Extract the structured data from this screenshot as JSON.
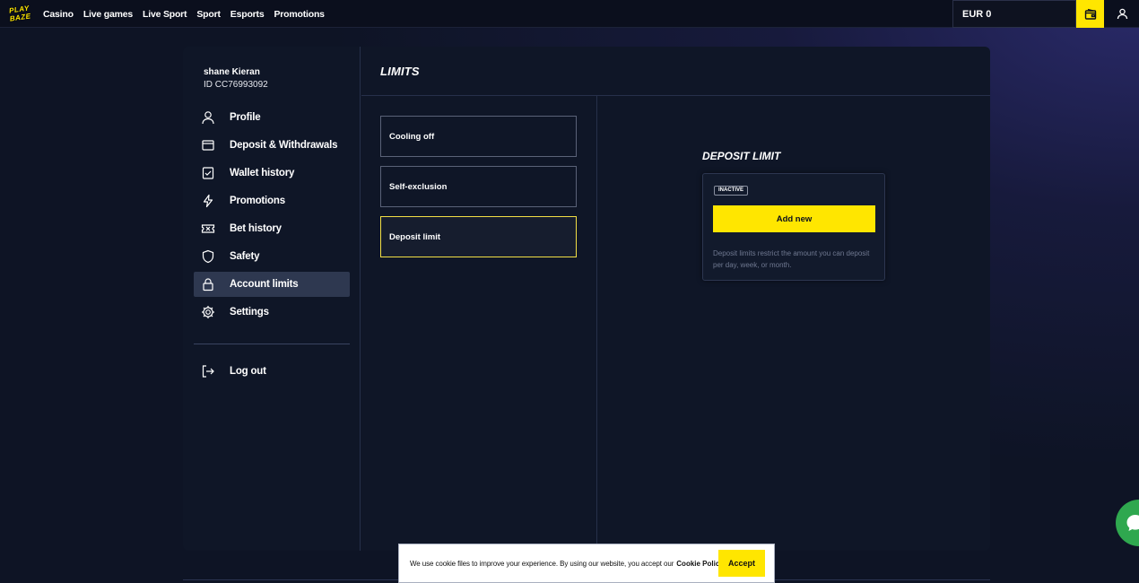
{
  "header": {
    "logo_top": "PLAY",
    "logo_bottom": "BAZE",
    "nav": [
      "Casino",
      "Live games",
      "Live Sport",
      "Sport",
      "Esports",
      "Promotions"
    ],
    "balance": "EUR 0"
  },
  "user": {
    "name": "shane Kieran",
    "id": "ID CC76993092"
  },
  "sidebar": {
    "items": [
      {
        "label": "Profile",
        "icon": "user-icon"
      },
      {
        "label": "Deposit & Withdrawals",
        "icon": "wallet-icon"
      },
      {
        "label": "Wallet history",
        "icon": "checklist-icon"
      },
      {
        "label": "Promotions",
        "icon": "lightning-icon"
      },
      {
        "label": "Bet history",
        "icon": "ticket-icon"
      },
      {
        "label": "Safety",
        "icon": "shield-icon"
      },
      {
        "label": "Account limits",
        "icon": "lock-icon",
        "active": true
      },
      {
        "label": "Settings",
        "icon": "gear-icon"
      }
    ],
    "logout": "Log out"
  },
  "limits": {
    "title": "LIMITS",
    "options": [
      {
        "label": "Cooling off"
      },
      {
        "label": "Self-exclusion"
      },
      {
        "label": "Deposit limit",
        "selected": true
      }
    ]
  },
  "deposit_limit": {
    "title": "DEPOSIT LIMIT",
    "status": "INACTIVE",
    "add_label": "Add new",
    "description": "Deposit limits restrict the amount you can deposit per day, week, or month."
  },
  "cookie": {
    "text": "We use cookie files to improve your experience. By using our website, you accept our",
    "link": "Cookie Policy",
    "accept": "Accept"
  },
  "colors": {
    "accent": "#ffe600",
    "panel": "#0f1627",
    "active_item": "#2e3850",
    "chat": "#2fa84f"
  }
}
